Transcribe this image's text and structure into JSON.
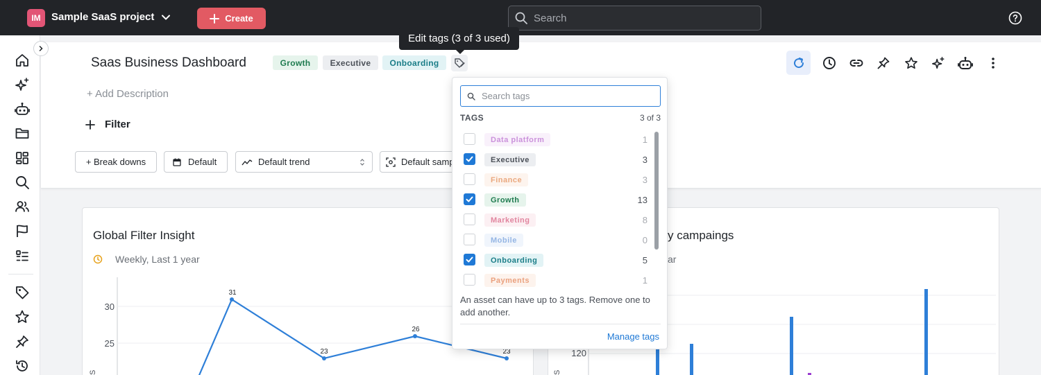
{
  "topbar": {
    "project_initials": "IM",
    "project_name": "Sample SaaS project",
    "create_label": "Create",
    "search_placeholder": "Search"
  },
  "tooltip": "Edit tags (3 of 3 used)",
  "dashboard": {
    "title": "Saas Business Dashboard",
    "tags": [
      {
        "label": "Growth",
        "color": "#1e7b4f",
        "bg": "#e6f4ec"
      },
      {
        "label": "Executive",
        "color": "#4b5058",
        "bg": "#eceef1"
      },
      {
        "label": "Onboarding",
        "color": "#1a7d87",
        "bg": "#e2f3f5"
      }
    ],
    "add_description": "+ Add Description",
    "filter_label": "Filter",
    "controls": {
      "breakdowns": "+ Break downs",
      "default": "Default",
      "trend": "Default trend",
      "sampling": "Default samp"
    }
  },
  "cards": [
    {
      "title": "Global Filter Insight",
      "subtitle": "Weekly, Last 1 year"
    },
    {
      "title": "y campaings",
      "subtitle": "ar"
    }
  ],
  "chart_left": {
    "y_ticks": [
      "30",
      "25"
    ],
    "point_labels": [
      "31",
      "23",
      "26",
      "23"
    ],
    "axis_label": "S"
  },
  "chart_right": {
    "y_ticks": [
      "120"
    ],
    "axis_label": "S"
  },
  "tag_popover": {
    "search_placeholder": "Search tags",
    "header_label": "TAGS",
    "header_count": "3 of 3",
    "tags": [
      {
        "label": "Data platform",
        "count": "1",
        "checked": false,
        "color": "#b057c9",
        "bg": "#f6ebf9",
        "disabled": true
      },
      {
        "label": "Executive",
        "count": "3",
        "checked": true,
        "color": "#4b5058",
        "bg": "#eceef1",
        "disabled": false
      },
      {
        "label": "Finance",
        "count": "3",
        "checked": false,
        "color": "#e07a3a",
        "bg": "#fcefe5",
        "disabled": true
      },
      {
        "label": "Growth",
        "count": "13",
        "checked": true,
        "color": "#1e7b4f",
        "bg": "#e6f4ec",
        "disabled": false
      },
      {
        "label": "Marketing",
        "count": "8",
        "checked": false,
        "color": "#d2456c",
        "bg": "#fbe9ee",
        "disabled": true
      },
      {
        "label": "Mobile",
        "count": "0",
        "checked": false,
        "color": "#5b8fd6",
        "bg": "#e9f1fb",
        "disabled": true
      },
      {
        "label": "Onboarding",
        "count": "5",
        "checked": true,
        "color": "#1a7d87",
        "bg": "#e2f3f5",
        "disabled": false
      },
      {
        "label": "Payments",
        "count": "1",
        "checked": false,
        "color": "#e06f3a",
        "bg": "#fcede4",
        "disabled": true
      }
    ],
    "note": "An asset can have up to 3 tags. Remove one to add another.",
    "manage_label": "Manage tags"
  }
}
